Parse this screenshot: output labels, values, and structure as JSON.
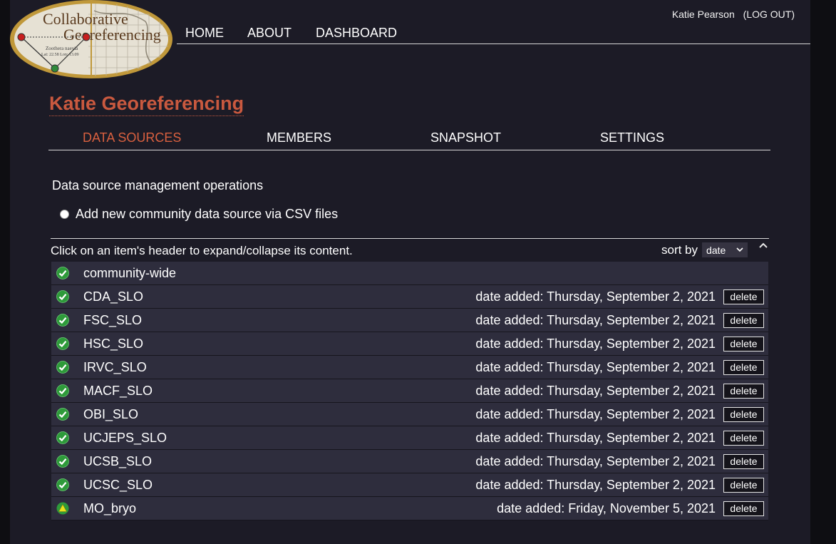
{
  "logo": {
    "line1": "Collaborative",
    "line2": "Georeferencing",
    "caption1": "Zoothera naevia",
    "caption2": "Lat: 22.58  Lon: 13.09"
  },
  "user": {
    "name": "Katie Pearson",
    "logout": "(LOG OUT)"
  },
  "topnav": {
    "home": "HOME",
    "about": "ABOUT",
    "dashboard": "DASHBOARD"
  },
  "project_title": "Katie Georeferencing",
  "tabs": {
    "data_sources": "DATA SOURCES",
    "members": "MEMBERS",
    "snapshot": "SNAPSHOT",
    "settings": "SETTINGS"
  },
  "ops": {
    "title": "Data source management operations",
    "add_csv": "Add new community data source via CSV files"
  },
  "list": {
    "hint": "Click on an item's header to expand/collapse its content.",
    "sort_label": "sort by",
    "sort_value": "date",
    "delete_label": "delete",
    "rows": [
      {
        "name": "community-wide",
        "date": "",
        "status": "ok"
      },
      {
        "name": "CDA_SLO",
        "date": "date added: Thursday, September 2, 2021",
        "status": "ok"
      },
      {
        "name": "FSC_SLO",
        "date": "date added: Thursday, September 2, 2021",
        "status": "ok"
      },
      {
        "name": "HSC_SLO",
        "date": "date added: Thursday, September 2, 2021",
        "status": "ok"
      },
      {
        "name": "IRVC_SLO",
        "date": "date added: Thursday, September 2, 2021",
        "status": "ok"
      },
      {
        "name": "MACF_SLO",
        "date": "date added: Thursday, September 2, 2021",
        "status": "ok"
      },
      {
        "name": "OBI_SLO",
        "date": "date added: Thursday, September 2, 2021",
        "status": "ok"
      },
      {
        "name": "UCJEPS_SLO",
        "date": "date added: Thursday, September 2, 2021",
        "status": "ok"
      },
      {
        "name": "UCSB_SLO",
        "date": "date added: Thursday, September 2, 2021",
        "status": "ok"
      },
      {
        "name": "UCSC_SLO",
        "date": "date added: Thursday, September 2, 2021",
        "status": "ok"
      },
      {
        "name": "MO_bryo",
        "date": "date added: Friday, November 5, 2021",
        "status": "warning"
      }
    ]
  },
  "colors": {
    "accent": "#c9593f",
    "status_ok": "#2e9a3a",
    "status_warning": "#d8d41a"
  }
}
